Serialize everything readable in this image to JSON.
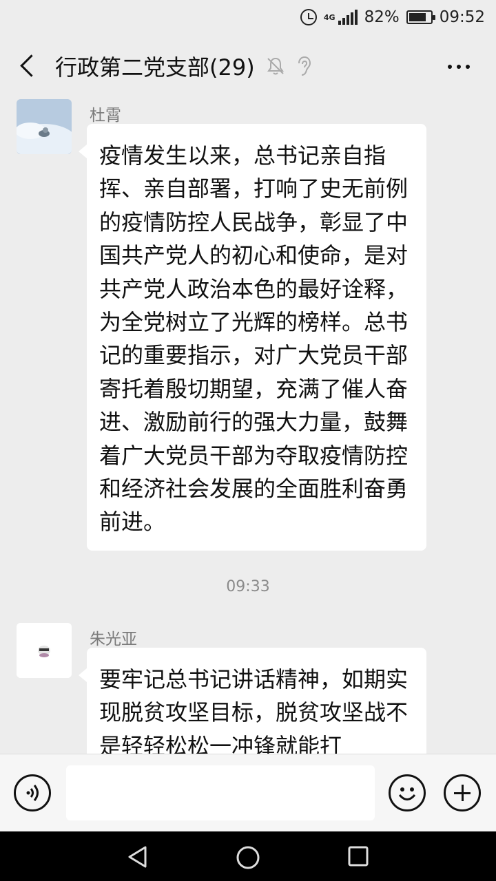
{
  "status_bar": {
    "network": "4G",
    "battery": "82%",
    "time": "09:52"
  },
  "header": {
    "title": "行政第二党支部(29)",
    "icons": [
      "back-icon",
      "mute-icon",
      "ear-icon",
      "more-icon"
    ]
  },
  "messages": [
    {
      "sender": "杜霄",
      "text": "疫情发生以来，总书记亲自指挥、亲自部署，打响了史无前例的疫情防控人民战争，彰显了中国共产党人的初心和使命，是对共产党人政治本色的最好诠释，为全党树立了光辉的榜样。总书记的重要指示，对广大党员干部寄托着殷切期望，充满了催人奋进、激励前行的强大力量，鼓舞着广大党员干部为夺取疫情防控和经济社会发展的全面胜利奋勇前进。"
    },
    {
      "sender": "朱光亚",
      "text": "要牢记总书记讲话精神，如期实现脱贫攻坚目标，脱贫攻坚战不是轻轻松松一冲锋就能打"
    }
  ],
  "time_divider": "09:33",
  "input_bar": {
    "placeholder": "",
    "icons": [
      "voice-icon",
      "emoji-icon",
      "plus-icon"
    ]
  },
  "system_nav": {
    "icons": [
      "nav-back-icon",
      "nav-home-icon",
      "nav-recent-icon"
    ]
  }
}
